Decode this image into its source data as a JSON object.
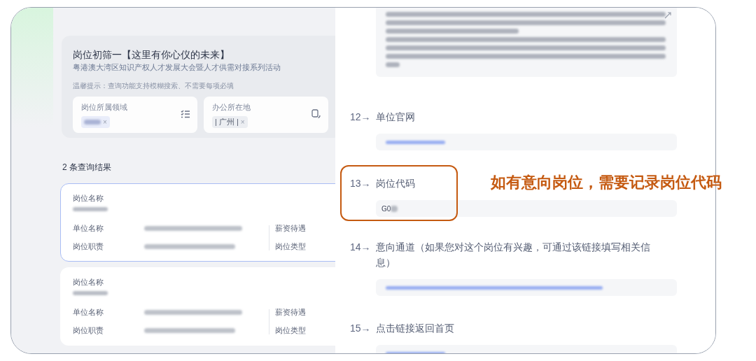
{
  "filter_panel": {
    "title": "岗位初筛一【这里有你心仪的未来】",
    "subtitle": "粤港澳大湾区知识产权人才发展大会暨人才供需对接系列活动",
    "hint": "温馨提示：查询功能支持模糊搜索、不需要每项必填",
    "fields": [
      {
        "label": "岗位所属领域",
        "remove": "×",
        "kind": "list"
      },
      {
        "label": "办公所在地",
        "tag": "| 广州 |",
        "remove": "×",
        "kind": "map"
      }
    ]
  },
  "results_count": "2 条查询结果",
  "results": [
    {
      "selected": true,
      "name_label": "岗位名称",
      "company_label": "单位名称",
      "duty_label": "岗位职责",
      "salary_label": "薪资待遇",
      "type_label": "岗位类型"
    },
    {
      "selected": false,
      "name_label": "岗位名称",
      "company_label": "单位名称",
      "duty_label": "岗位职责",
      "salary_label": "薪资待遇",
      "type_label": "岗位类型"
    }
  ],
  "questions": [
    {
      "kind": "paragraph",
      "highlighted": false
    },
    {
      "number": "12→",
      "label": "单位官网",
      "kind": "link",
      "highlighted": false
    },
    {
      "number": "13→",
      "label": "岗位代码",
      "kind": "code",
      "answer": "G0",
      "highlighted": true
    },
    {
      "number": "14→",
      "label": "意向通道（如果您对这个岗位有兴趣，可通过该链接填写相关信息）",
      "kind": "link",
      "highlighted": false
    },
    {
      "number": "15→",
      "label": "点击链接返回首页",
      "kind": "link",
      "highlighted": false
    }
  ],
  "annotation": "如有意向岗位，需要记录岗位代码"
}
